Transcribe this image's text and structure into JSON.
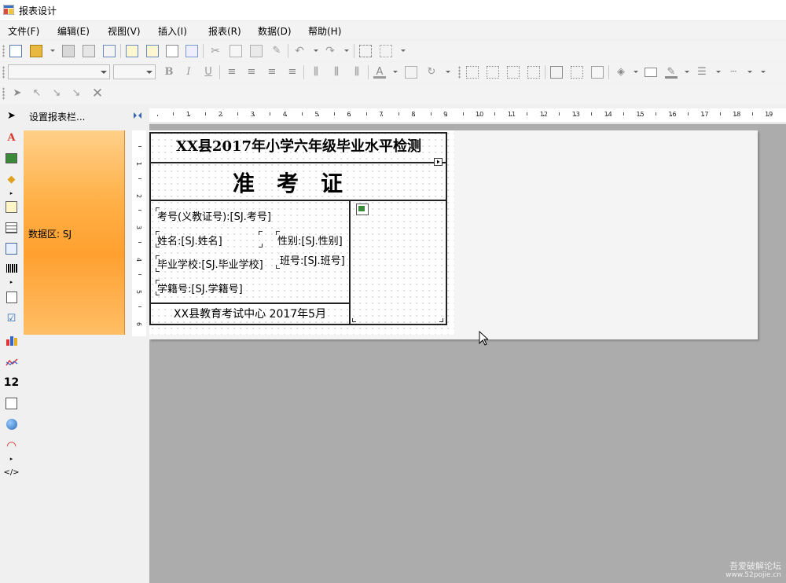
{
  "window": {
    "title": "报表设计"
  },
  "menu": [
    "文件(F)",
    "编辑(E)",
    "视图(V)",
    "插入(I)",
    "报表(R)",
    "数据(D)",
    "帮助(H)"
  ],
  "band_panel": {
    "header": "设置报表栏...",
    "band_label": "数据区: SJ"
  },
  "ruler": {
    "h_numbers": [
      "1",
      "2",
      "3",
      "4",
      "5",
      "6",
      "7",
      "8",
      "9",
      "10",
      "11",
      "12",
      "13",
      "14",
      "15",
      "16",
      "17",
      "18",
      "19"
    ],
    "v_numbers": [
      "1",
      "2",
      "3",
      "4",
      "5",
      "6"
    ]
  },
  "report": {
    "title": "XX县2017年小学六年级毕业水平检测",
    "subtitle": "准考证",
    "fields": {
      "exam_no": "考号(义教证号):[SJ.考号]",
      "name": "姓名:[SJ.姓名]",
      "gender": "性别:[SJ.性别]",
      "school": "毕业学校:[SJ.毕业学校]",
      "class": "班号:[SJ.班号]",
      "student_id": "学籍号:[SJ.学籍号]"
    },
    "footer": "XX县教育考试中心 2017年5月"
  },
  "watermark": {
    "line1": "吾爱破解论坛",
    "line2": "www.52pojie.cn"
  }
}
